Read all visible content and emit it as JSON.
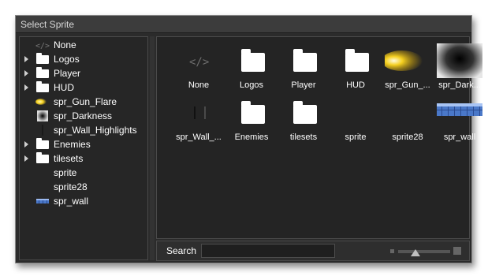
{
  "window": {
    "title": "Select Sprite"
  },
  "tree": {
    "items": [
      {
        "label": "None",
        "icon": "code-icon",
        "expandable": false
      },
      {
        "label": "Logos",
        "icon": "folder-icon",
        "expandable": true
      },
      {
        "label": "Player",
        "icon": "folder-icon",
        "expandable": true
      },
      {
        "label": "HUD",
        "icon": "folder-icon",
        "expandable": true
      },
      {
        "label": "spr_Gun_Flare",
        "icon": "flare-sprite-icon",
        "expandable": false
      },
      {
        "label": "spr_Darkness",
        "icon": "darkness-sprite-icon",
        "expandable": false
      },
      {
        "label": "spr_Wall_Highlights",
        "icon": "wall-highlights-sprite-icon",
        "expandable": false
      },
      {
        "label": "Enemies",
        "icon": "folder-icon",
        "expandable": true
      },
      {
        "label": "tilesets",
        "icon": "folder-icon",
        "expandable": true
      },
      {
        "label": "sprite",
        "icon": "",
        "expandable": false
      },
      {
        "label": "sprite28",
        "icon": "",
        "expandable": false
      },
      {
        "label": "spr_wall",
        "icon": "wall-sprite-icon",
        "expandable": false
      }
    ]
  },
  "grid": {
    "items": [
      {
        "label": "None",
        "icon": "code-icon"
      },
      {
        "label": "Logos",
        "icon": "folder-icon"
      },
      {
        "label": "Player",
        "icon": "folder-icon"
      },
      {
        "label": "HUD",
        "icon": "folder-icon"
      },
      {
        "label": "spr_Gun_...",
        "icon": "flare-sprite-icon"
      },
      {
        "label": "spr_Dark...",
        "icon": "darkness-sprite-icon"
      },
      {
        "label": "spr_Wall_...",
        "icon": "wall-highlights-sprite-icon"
      },
      {
        "label": "Enemies",
        "icon": "folder-icon"
      },
      {
        "label": "tilesets",
        "icon": "folder-icon"
      },
      {
        "label": "sprite",
        "icon": ""
      },
      {
        "label": "sprite28",
        "icon": ""
      },
      {
        "label": "spr_wall",
        "icon": "wall-sprite-icon"
      }
    ]
  },
  "search": {
    "label": "Search",
    "value": ""
  },
  "colors": {
    "background": "#2b2b2b",
    "text": "#ffffff",
    "flare": "#f5d020",
    "wall": "#4a78c8"
  }
}
